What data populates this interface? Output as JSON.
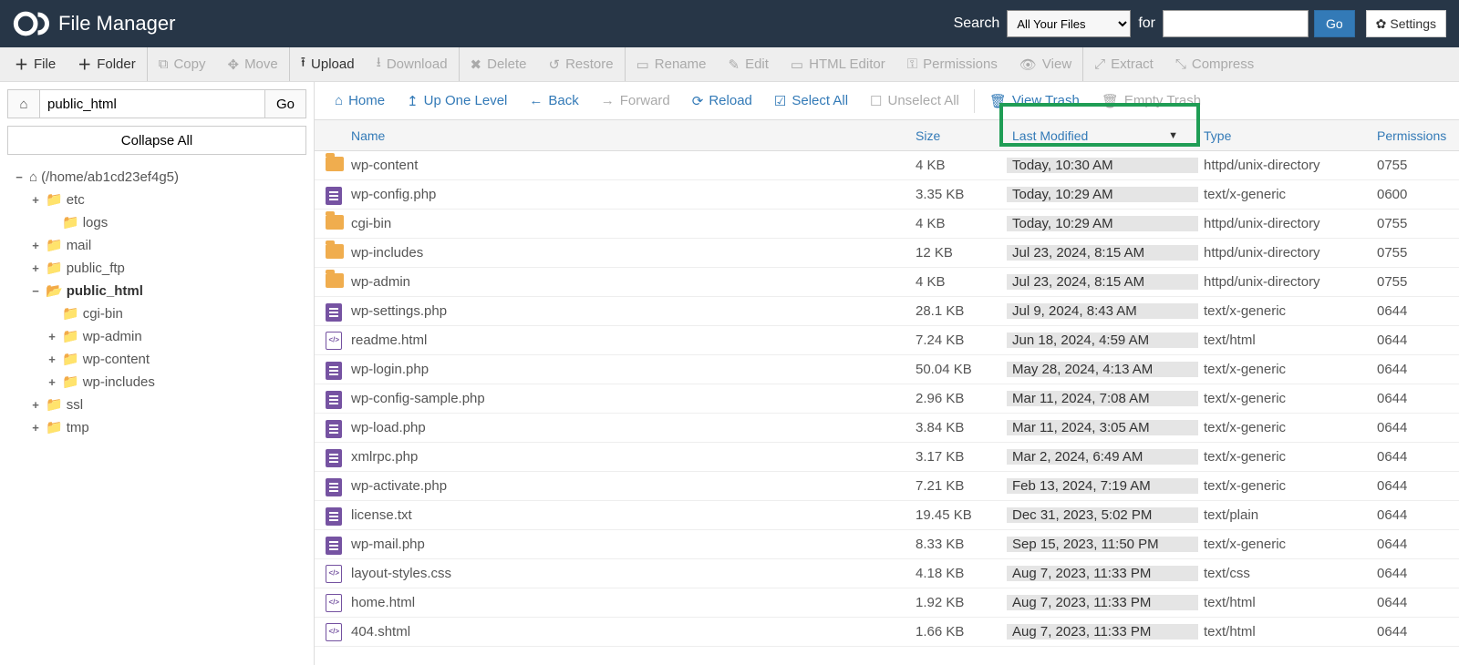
{
  "header": {
    "app_title": "File Manager",
    "search_label": "Search",
    "search_scope": "All Your Files",
    "for_label": "for",
    "go_label": "Go",
    "settings_label": "Settings"
  },
  "actions": {
    "file": "File",
    "folder": "Folder",
    "copy": "Copy",
    "move": "Move",
    "upload": "Upload",
    "download": "Download",
    "delete": "Delete",
    "restore": "Restore",
    "rename": "Rename",
    "edit": "Edit",
    "html_editor": "HTML Editor",
    "permissions": "Permissions",
    "view": "View",
    "extract": "Extract",
    "compress": "Compress"
  },
  "left": {
    "path_value": "public_html",
    "go_label": "Go",
    "collapse_label": "Collapse All",
    "root_label": "(/home/ab1cd23ef4g5)",
    "tree": {
      "etc": "etc",
      "logs": "logs",
      "mail": "mail",
      "public_ftp": "public_ftp",
      "public_html": "public_html",
      "cgi_bin": "cgi-bin",
      "wp_admin": "wp-admin",
      "wp_content": "wp-content",
      "wp_includes": "wp-includes",
      "ssl": "ssl",
      "tmp": "tmp"
    }
  },
  "nav": {
    "home": "Home",
    "up": "Up One Level",
    "back": "Back",
    "forward": "Forward",
    "reload": "Reload",
    "select_all": "Select All",
    "unselect_all": "Unselect All",
    "view_trash": "View Trash",
    "empty_trash": "Empty Trash"
  },
  "columns": {
    "name": "Name",
    "size": "Size",
    "modified": "Last Modified",
    "type": "Type",
    "permissions": "Permissions"
  },
  "rows": [
    {
      "icon": "folder",
      "name": "wp-content",
      "size": "4 KB",
      "mod": "Today, 10:30 AM",
      "type": "httpd/unix-directory",
      "perm": "0755"
    },
    {
      "icon": "file",
      "name": "wp-config.php",
      "size": "3.35 KB",
      "mod": "Today, 10:29 AM",
      "type": "text/x-generic",
      "perm": "0600"
    },
    {
      "icon": "folder",
      "name": "cgi-bin",
      "size": "4 KB",
      "mod": "Today, 10:29 AM",
      "type": "httpd/unix-directory",
      "perm": "0755"
    },
    {
      "icon": "folder",
      "name": "wp-includes",
      "size": "12 KB",
      "mod": "Jul 23, 2024, 8:15 AM",
      "type": "httpd/unix-directory",
      "perm": "0755"
    },
    {
      "icon": "folder",
      "name": "wp-admin",
      "size": "4 KB",
      "mod": "Jul 23, 2024, 8:15 AM",
      "type": "httpd/unix-directory",
      "perm": "0755"
    },
    {
      "icon": "file",
      "name": "wp-settings.php",
      "size": "28.1 KB",
      "mod": "Jul 9, 2024, 8:43 AM",
      "type": "text/x-generic",
      "perm": "0644"
    },
    {
      "icon": "code",
      "name": "readme.html",
      "size": "7.24 KB",
      "mod": "Jun 18, 2024, 4:59 AM",
      "type": "text/html",
      "perm": "0644"
    },
    {
      "icon": "file",
      "name": "wp-login.php",
      "size": "50.04 KB",
      "mod": "May 28, 2024, 4:13 AM",
      "type": "text/x-generic",
      "perm": "0644"
    },
    {
      "icon": "file",
      "name": "wp-config-sample.php",
      "size": "2.96 KB",
      "mod": "Mar 11, 2024, 7:08 AM",
      "type": "text/x-generic",
      "perm": "0644"
    },
    {
      "icon": "file",
      "name": "wp-load.php",
      "size": "3.84 KB",
      "mod": "Mar 11, 2024, 3:05 AM",
      "type": "text/x-generic",
      "perm": "0644"
    },
    {
      "icon": "file",
      "name": "xmlrpc.php",
      "size": "3.17 KB",
      "mod": "Mar 2, 2024, 6:49 AM",
      "type": "text/x-generic",
      "perm": "0644"
    },
    {
      "icon": "file",
      "name": "wp-activate.php",
      "size": "7.21 KB",
      "mod": "Feb 13, 2024, 7:19 AM",
      "type": "text/x-generic",
      "perm": "0644"
    },
    {
      "icon": "file",
      "name": "license.txt",
      "size": "19.45 KB",
      "mod": "Dec 31, 2023, 5:02 PM",
      "type": "text/plain",
      "perm": "0644"
    },
    {
      "icon": "file",
      "name": "wp-mail.php",
      "size": "8.33 KB",
      "mod": "Sep 15, 2023, 11:50 PM",
      "type": "text/x-generic",
      "perm": "0644"
    },
    {
      "icon": "code",
      "name": "layout-styles.css",
      "size": "4.18 KB",
      "mod": "Aug 7, 2023, 11:33 PM",
      "type": "text/css",
      "perm": "0644"
    },
    {
      "icon": "code",
      "name": "home.html",
      "size": "1.92 KB",
      "mod": "Aug 7, 2023, 11:33 PM",
      "type": "text/html",
      "perm": "0644"
    },
    {
      "icon": "code",
      "name": "404.shtml",
      "size": "1.66 KB",
      "mod": "Aug 7, 2023, 11:33 PM",
      "type": "text/html",
      "perm": "0644"
    }
  ]
}
